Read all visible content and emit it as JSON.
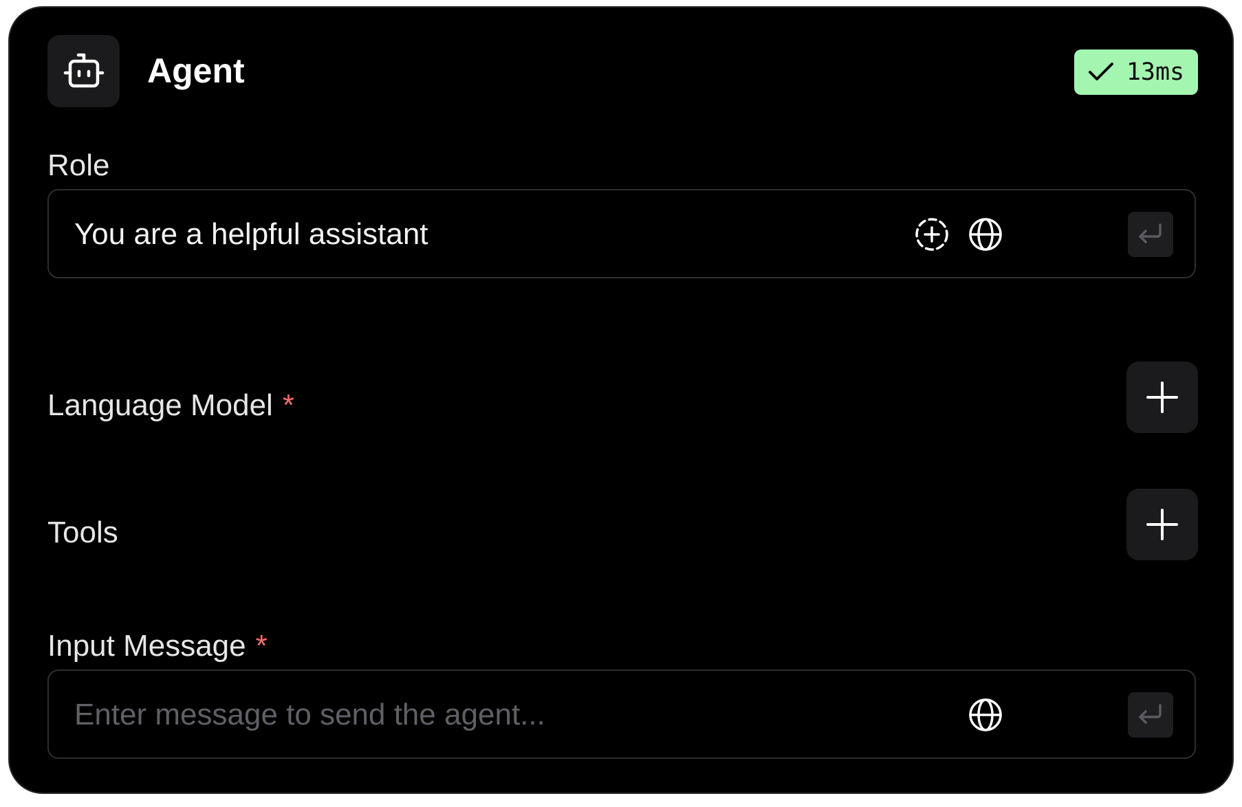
{
  "header": {
    "icon": "bot-icon",
    "title": "Agent",
    "status_icon": "check-icon",
    "status_text": "13ms",
    "status_color": "#a4f5b0"
  },
  "fields": {
    "role": {
      "label": "Role",
      "value": "You are a helpful assistant",
      "icons": [
        "add-variable-icon",
        "globe-icon",
        "enter-icon"
      ]
    },
    "language_model": {
      "label": "Language Model",
      "required_mark": "*",
      "action_icon": "plus-icon"
    },
    "tools": {
      "label": "Tools",
      "action_icon": "plus-icon"
    },
    "input_message": {
      "label": "Input Message",
      "required_mark": "*",
      "placeholder": "Enter message to send the agent...",
      "icons": [
        "globe-icon",
        "enter-icon"
      ]
    }
  },
  "colors": {
    "background": "#000000",
    "required": "#f26d6d"
  }
}
